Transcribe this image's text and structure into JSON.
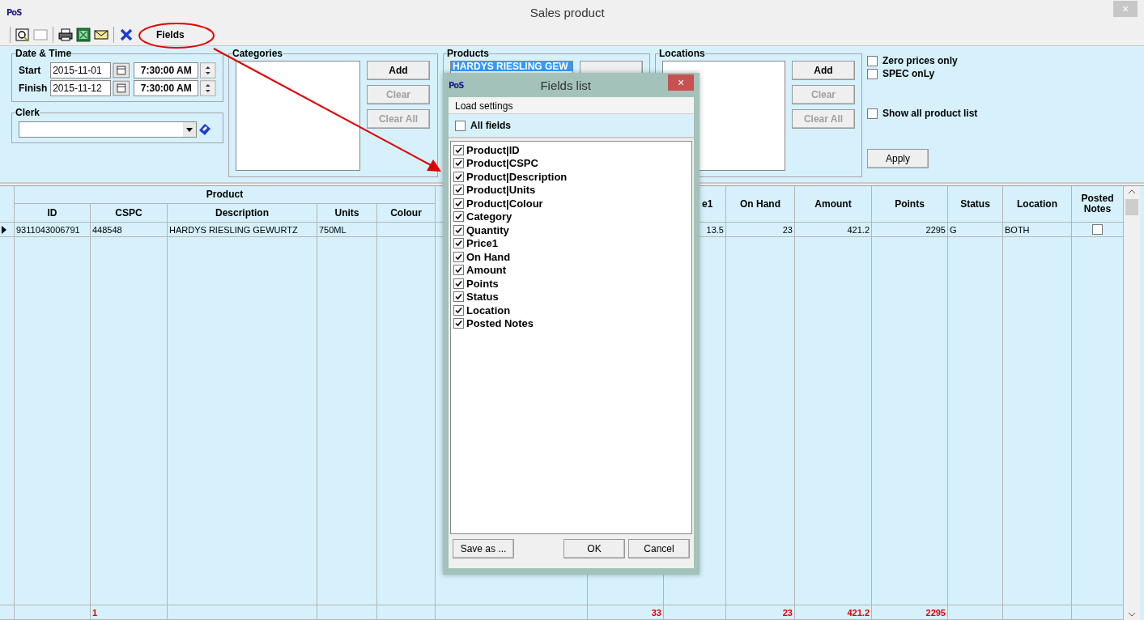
{
  "window": {
    "logo": "PoS",
    "title": "Sales product",
    "close": "×"
  },
  "toolbar": {
    "fields_button": "Fields"
  },
  "filters": {
    "date_time": {
      "title": "Date & Time",
      "start_label": "Start",
      "start_date": "2015-11-01",
      "start_time": "7:30:00 AM",
      "finish_label": "Finish",
      "finish_date": "2015-11-12",
      "finish_time": "7:30:00 AM"
    },
    "clerk": {
      "title": "Clerk"
    },
    "categories": {
      "title": "Categories",
      "buttons": [
        {
          "label": "Add",
          "disabled": false
        },
        {
          "label": "Clear",
          "disabled": true
        },
        {
          "label": "Clear All",
          "disabled": true
        }
      ]
    },
    "products": {
      "title": "Products",
      "items": [
        {
          "label": "HARDYS RIESLING GEW",
          "selected": true
        }
      ]
    },
    "locations": {
      "title": "Locations",
      "buttons": [
        {
          "label": "Add",
          "disabled": false
        },
        {
          "label": "Clear",
          "disabled": true
        },
        {
          "label": "Clear All",
          "disabled": true
        }
      ]
    },
    "options": [
      {
        "label": "Zero prices only",
        "checked": false
      },
      {
        "label": "SPEC onLy",
        "checked": false
      },
      {
        "label": "Show all product list",
        "checked": false
      }
    ],
    "apply_button": "Apply"
  },
  "grid": {
    "group_header": "Product",
    "columns": [
      {
        "label": "ID",
        "grouped": true,
        "kind": "text"
      },
      {
        "label": "CSPC",
        "grouped": true,
        "kind": "text"
      },
      {
        "label": "Description",
        "grouped": true,
        "kind": "text"
      },
      {
        "label": "Units",
        "grouped": true,
        "kind": "text"
      },
      {
        "label": "Colour",
        "grouped": true,
        "kind": "text"
      },
      {
        "grouped": false,
        "kind": "text"
      },
      {
        "kind": "number"
      },
      {
        "label": "e1",
        "grouped": false,
        "kind": "number"
      },
      {
        "label": "On Hand",
        "grouped": false,
        "kind": "number"
      },
      {
        "label": "Amount",
        "grouped": false,
        "kind": "number"
      },
      {
        "label": "Points",
        "grouped": false,
        "kind": "number"
      },
      {
        "label": "Status",
        "grouped": false,
        "kind": "text"
      },
      {
        "label": "Location",
        "grouped": false,
        "kind": "text"
      },
      {
        "label": "Posted Notes",
        "grouped": false,
        "kind": "check"
      }
    ],
    "rows": [
      {
        "kind": "data",
        "current": true,
        "posted_notes_checked": false,
        "cells": [
          "9311043006791",
          "448548",
          "HARDYS RIESLING GEWURTZ",
          "750ML",
          null,
          null,
          null,
          "13.5",
          "23",
          "421.2",
          "2295",
          "G",
          "BOTH",
          null
        ]
      },
      {
        "kind": "total",
        "cells": [
          null,
          "1",
          null,
          null,
          null,
          null,
          "33",
          null,
          "23",
          "421.2",
          "2295",
          null,
          null,
          null
        ]
      }
    ]
  },
  "dialog": {
    "logo": "PoS",
    "title": "Fields list",
    "close": "×",
    "load_settings": "Load settings",
    "all_fields": {
      "label": "All fields",
      "checked": false
    },
    "fields": [
      {
        "label": "Product|ID",
        "checked": true
      },
      {
        "label": "Product|CSPC",
        "checked": true
      },
      {
        "label": "Product|Description",
        "checked": true
      },
      {
        "label": "Product|Units",
        "checked": true
      },
      {
        "label": "Product|Colour",
        "checked": true
      },
      {
        "label": "Category",
        "checked": true
      },
      {
        "label": "Quantity",
        "checked": true
      },
      {
        "label": "Price1",
        "checked": true
      },
      {
        "label": "On Hand",
        "checked": true
      },
      {
        "label": "Amount",
        "checked": true
      },
      {
        "label": "Points",
        "checked": true
      },
      {
        "label": "Status",
        "checked": true
      },
      {
        "label": "Location",
        "checked": true
      },
      {
        "label": "Posted Notes",
        "checked": true
      }
    ],
    "save_button": "Save as ...",
    "ok_button": "OK",
    "cancel_button": "Cancel"
  }
}
